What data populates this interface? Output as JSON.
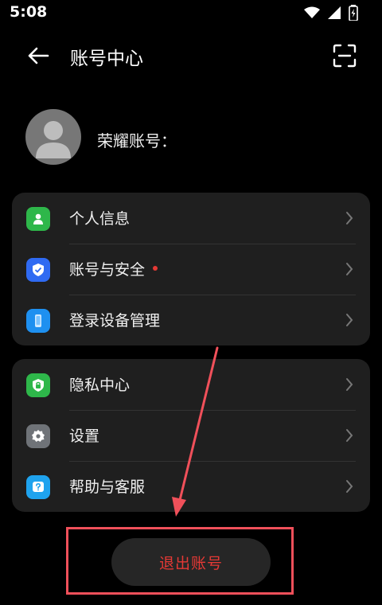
{
  "status_bar": {
    "time": "5:08"
  },
  "header": {
    "title": "账号中心"
  },
  "profile": {
    "account_label": "荣耀账号："
  },
  "groups": [
    {
      "items": [
        {
          "label": "个人信息",
          "icon": "person-card-icon",
          "color": "#2eb74a"
        },
        {
          "label": "账号与安全",
          "icon": "shield-check-icon",
          "color": "#2f6af2",
          "has_badge": true
        },
        {
          "label": "登录设备管理",
          "icon": "phone-device-icon",
          "color": "#1e90f0"
        }
      ]
    },
    {
      "items": [
        {
          "label": "隐私中心",
          "icon": "lock-shield-icon",
          "color": "#2eb74a"
        },
        {
          "label": "设置",
          "icon": "gear-icon",
          "color": "#6f7378"
        },
        {
          "label": "帮助与客服",
          "icon": "question-icon",
          "color": "#1fa3ee"
        }
      ]
    }
  ],
  "logout": {
    "label": "退出账号",
    "color": "#e53935"
  },
  "annotation": {
    "color": "#f0505a"
  }
}
